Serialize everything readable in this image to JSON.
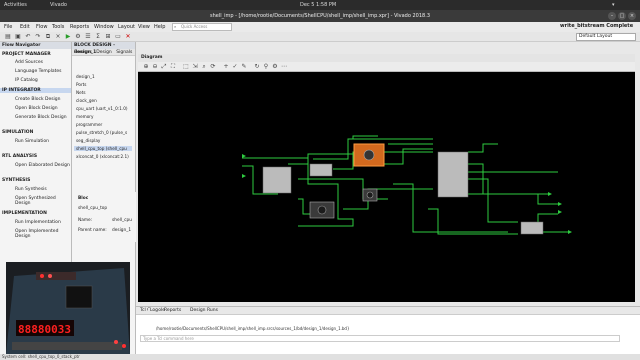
{
  "topbar": {
    "activities": "Activities",
    "app": "Vivado",
    "datetime": "Dec 5  1:58 PM"
  },
  "titlebar": {
    "title": "shell_imp - [/home/rootie/Documents/ShellCPU/shell_imp/shell_imp.xpr] - Vivado 2018.3"
  },
  "menu": [
    "File",
    "Edit",
    "Flow",
    "Tools",
    "Reports",
    "Window",
    "Layout",
    "View",
    "Help"
  ],
  "search": {
    "placeholder": "Quick Access"
  },
  "status_right": {
    "label": "write_bitstream Complete"
  },
  "layout_select": {
    "value": "Default Layout"
  },
  "flow_navigator": {
    "title": "Flow Navigator",
    "sections": [
      {
        "label": "PROJECT MANAGER",
        "items": [
          "Add Sources",
          "Language Templates",
          "IP Catalog"
        ]
      },
      {
        "label": "IP INTEGRATOR",
        "items": [
          "Create Block Design",
          "Open Block Design",
          "Generate Block Design"
        ]
      },
      {
        "label": "SIMULATION",
        "items": [
          "Run Simulation"
        ]
      },
      {
        "label": "RTL ANALYSIS",
        "items": [
          "Open Elaborated Design"
        ]
      },
      {
        "label": "SYNTHESIS",
        "items": [
          "Run Synthesis",
          "Open Synthesized Design"
        ]
      },
      {
        "label": "IMPLEMENTATION",
        "items": [
          "Run Implementation",
          "Open Implemented Design"
        ]
      }
    ]
  },
  "block_design": {
    "header": "BLOCK DESIGN - design_1",
    "tabs": [
      "Sources",
      "Design",
      "Signals"
    ],
    "tree": [
      "design_1",
      "Ports",
      "Nets",
      "clock_gen",
      "cpu_uart (uart_v1_0:1.0)",
      "memory",
      "programmer",
      "pulse_stretch_0 (pulse_s",
      "seg_display",
      "shell_cpu_top (shell_cpu",
      "xlconcat_0 (xlconcat:2.1)"
    ]
  },
  "properties": {
    "header": "Bloc",
    "item": "shell_cpu_top",
    "name_label": "Name:",
    "name_value": "shell_cpu",
    "parent_label": "Parent name:",
    "parent_value": "design_1"
  },
  "diagram": {
    "tab": "Diagram"
  },
  "bottom_tabs": [
    "Tcl Console",
    "Log",
    "Reports",
    "Design Runs"
  ],
  "console": {
    "path_line": "/home/rootie/Documents/ShellCPU/shell_imp/shell_imp.srcs/sources_1/bd/design_1/design_1.bd}",
    "prompt_placeholder": "Type a Tcl command here"
  },
  "statusbar": {
    "text": "System cell: shell_cpu_top_0_stack_ptr"
  },
  "webcam": {
    "display_digits": "88880033"
  },
  "colors": {
    "wire": "#2ecc40",
    "selected_block": "#d2691e",
    "canvas": "#000000"
  }
}
